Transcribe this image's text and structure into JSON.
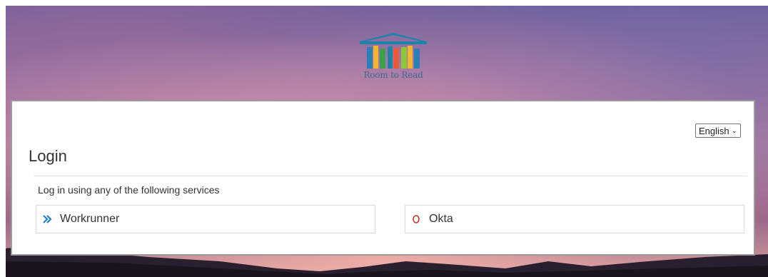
{
  "brand": {
    "logo_text": "Room to Read"
  },
  "language": {
    "selected": "English"
  },
  "login": {
    "title": "Login",
    "subtitle": "Log in using any of the following services"
  },
  "services": [
    {
      "label": "Workrunner",
      "icon": "double-chevron-right-icon",
      "icon_color": "#1e7fd0"
    },
    {
      "label": "Okta",
      "icon": "okta-o-icon",
      "icon_color": "#c0392b"
    }
  ],
  "colors": {
    "panel_border": "#9a9a9a",
    "service_border": "#d9d9d9",
    "logo_blue": "#1d83a8"
  }
}
